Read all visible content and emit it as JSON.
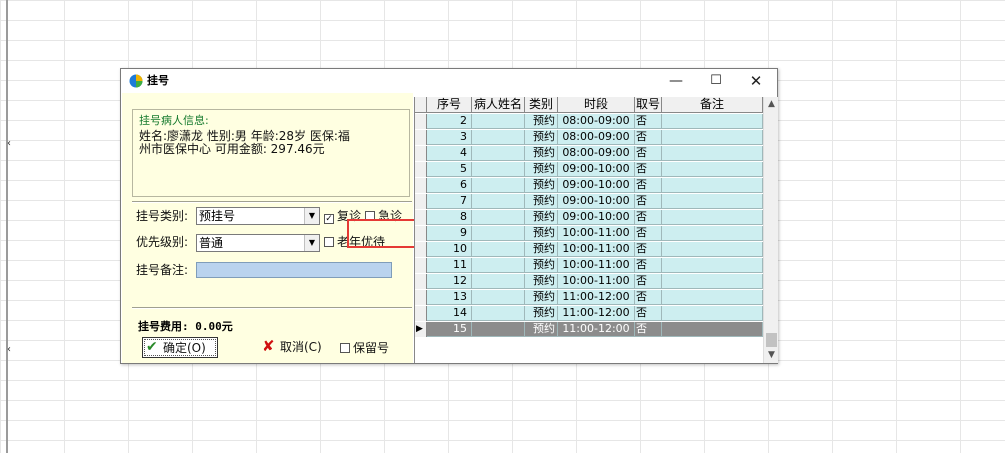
{
  "window": {
    "title": "挂号",
    "minimize": "—",
    "maximize": "☐",
    "close": "✕"
  },
  "patient_info": {
    "title": "挂号病人信息:",
    "line1": "姓名:廖潇龙 性别:男 年龄:28岁 医保:福",
    "line2": "州市医保中心 可用金额: 297.46元"
  },
  "form": {
    "type_label": "挂号类别:",
    "type_value": "预挂号",
    "priority_label": "优先级别:",
    "priority_value": "普通",
    "remark_label": "挂号备注:",
    "remark_value": "",
    "return_visit": {
      "label": "复诊",
      "checked": true
    },
    "emergency": {
      "label": "急诊",
      "checked": false
    },
    "elderly": {
      "label": "老年优待",
      "checked": false
    },
    "reserve": {
      "label": "保留号",
      "checked": false
    },
    "fee_label": "挂号费用: 0.00元"
  },
  "buttons": {
    "ok": "确定(O)",
    "cancel": "取消(C)"
  },
  "table": {
    "columns": [
      "序号",
      "病人姓名",
      "类别",
      "时段",
      "取号",
      "备注"
    ],
    "rows": [
      {
        "no": "2",
        "name": "",
        "type": "预约",
        "time": "08:00-09:00",
        "take": "否",
        "note": ""
      },
      {
        "no": "3",
        "name": "",
        "type": "预约",
        "time": "08:00-09:00",
        "take": "否",
        "note": ""
      },
      {
        "no": "4",
        "name": "",
        "type": "预约",
        "time": "08:00-09:00",
        "take": "否",
        "note": ""
      },
      {
        "no": "5",
        "name": "",
        "type": "预约",
        "time": "09:00-10:00",
        "take": "否",
        "note": ""
      },
      {
        "no": "6",
        "name": "",
        "type": "预约",
        "time": "09:00-10:00",
        "take": "否",
        "note": ""
      },
      {
        "no": "7",
        "name": "",
        "type": "预约",
        "time": "09:00-10:00",
        "take": "否",
        "note": ""
      },
      {
        "no": "8",
        "name": "",
        "type": "预约",
        "time": "09:00-10:00",
        "take": "否",
        "note": ""
      },
      {
        "no": "9",
        "name": "",
        "type": "预约",
        "time": "10:00-11:00",
        "take": "否",
        "note": ""
      },
      {
        "no": "10",
        "name": "",
        "type": "预约",
        "time": "10:00-11:00",
        "take": "否",
        "note": ""
      },
      {
        "no": "11",
        "name": "",
        "type": "预约",
        "time": "10:00-11:00",
        "take": "否",
        "note": ""
      },
      {
        "no": "12",
        "name": "",
        "type": "预约",
        "time": "10:00-11:00",
        "take": "否",
        "note": ""
      },
      {
        "no": "13",
        "name": "",
        "type": "预约",
        "time": "11:00-12:00",
        "take": "否",
        "note": ""
      },
      {
        "no": "14",
        "name": "",
        "type": "预约",
        "time": "11:00-12:00",
        "take": "否",
        "note": ""
      },
      {
        "no": "15",
        "name": "",
        "type": "预约",
        "time": "11:00-12:00",
        "take": "否",
        "note": "",
        "selected": true
      }
    ]
  },
  "colors": {
    "panel_bg": "#ffffe1",
    "row_bg": "#cdeef0",
    "selected_row_bg": "#8c8c8c",
    "highlight": "#e53935",
    "remark_input_bg": "#b9d3ee"
  }
}
